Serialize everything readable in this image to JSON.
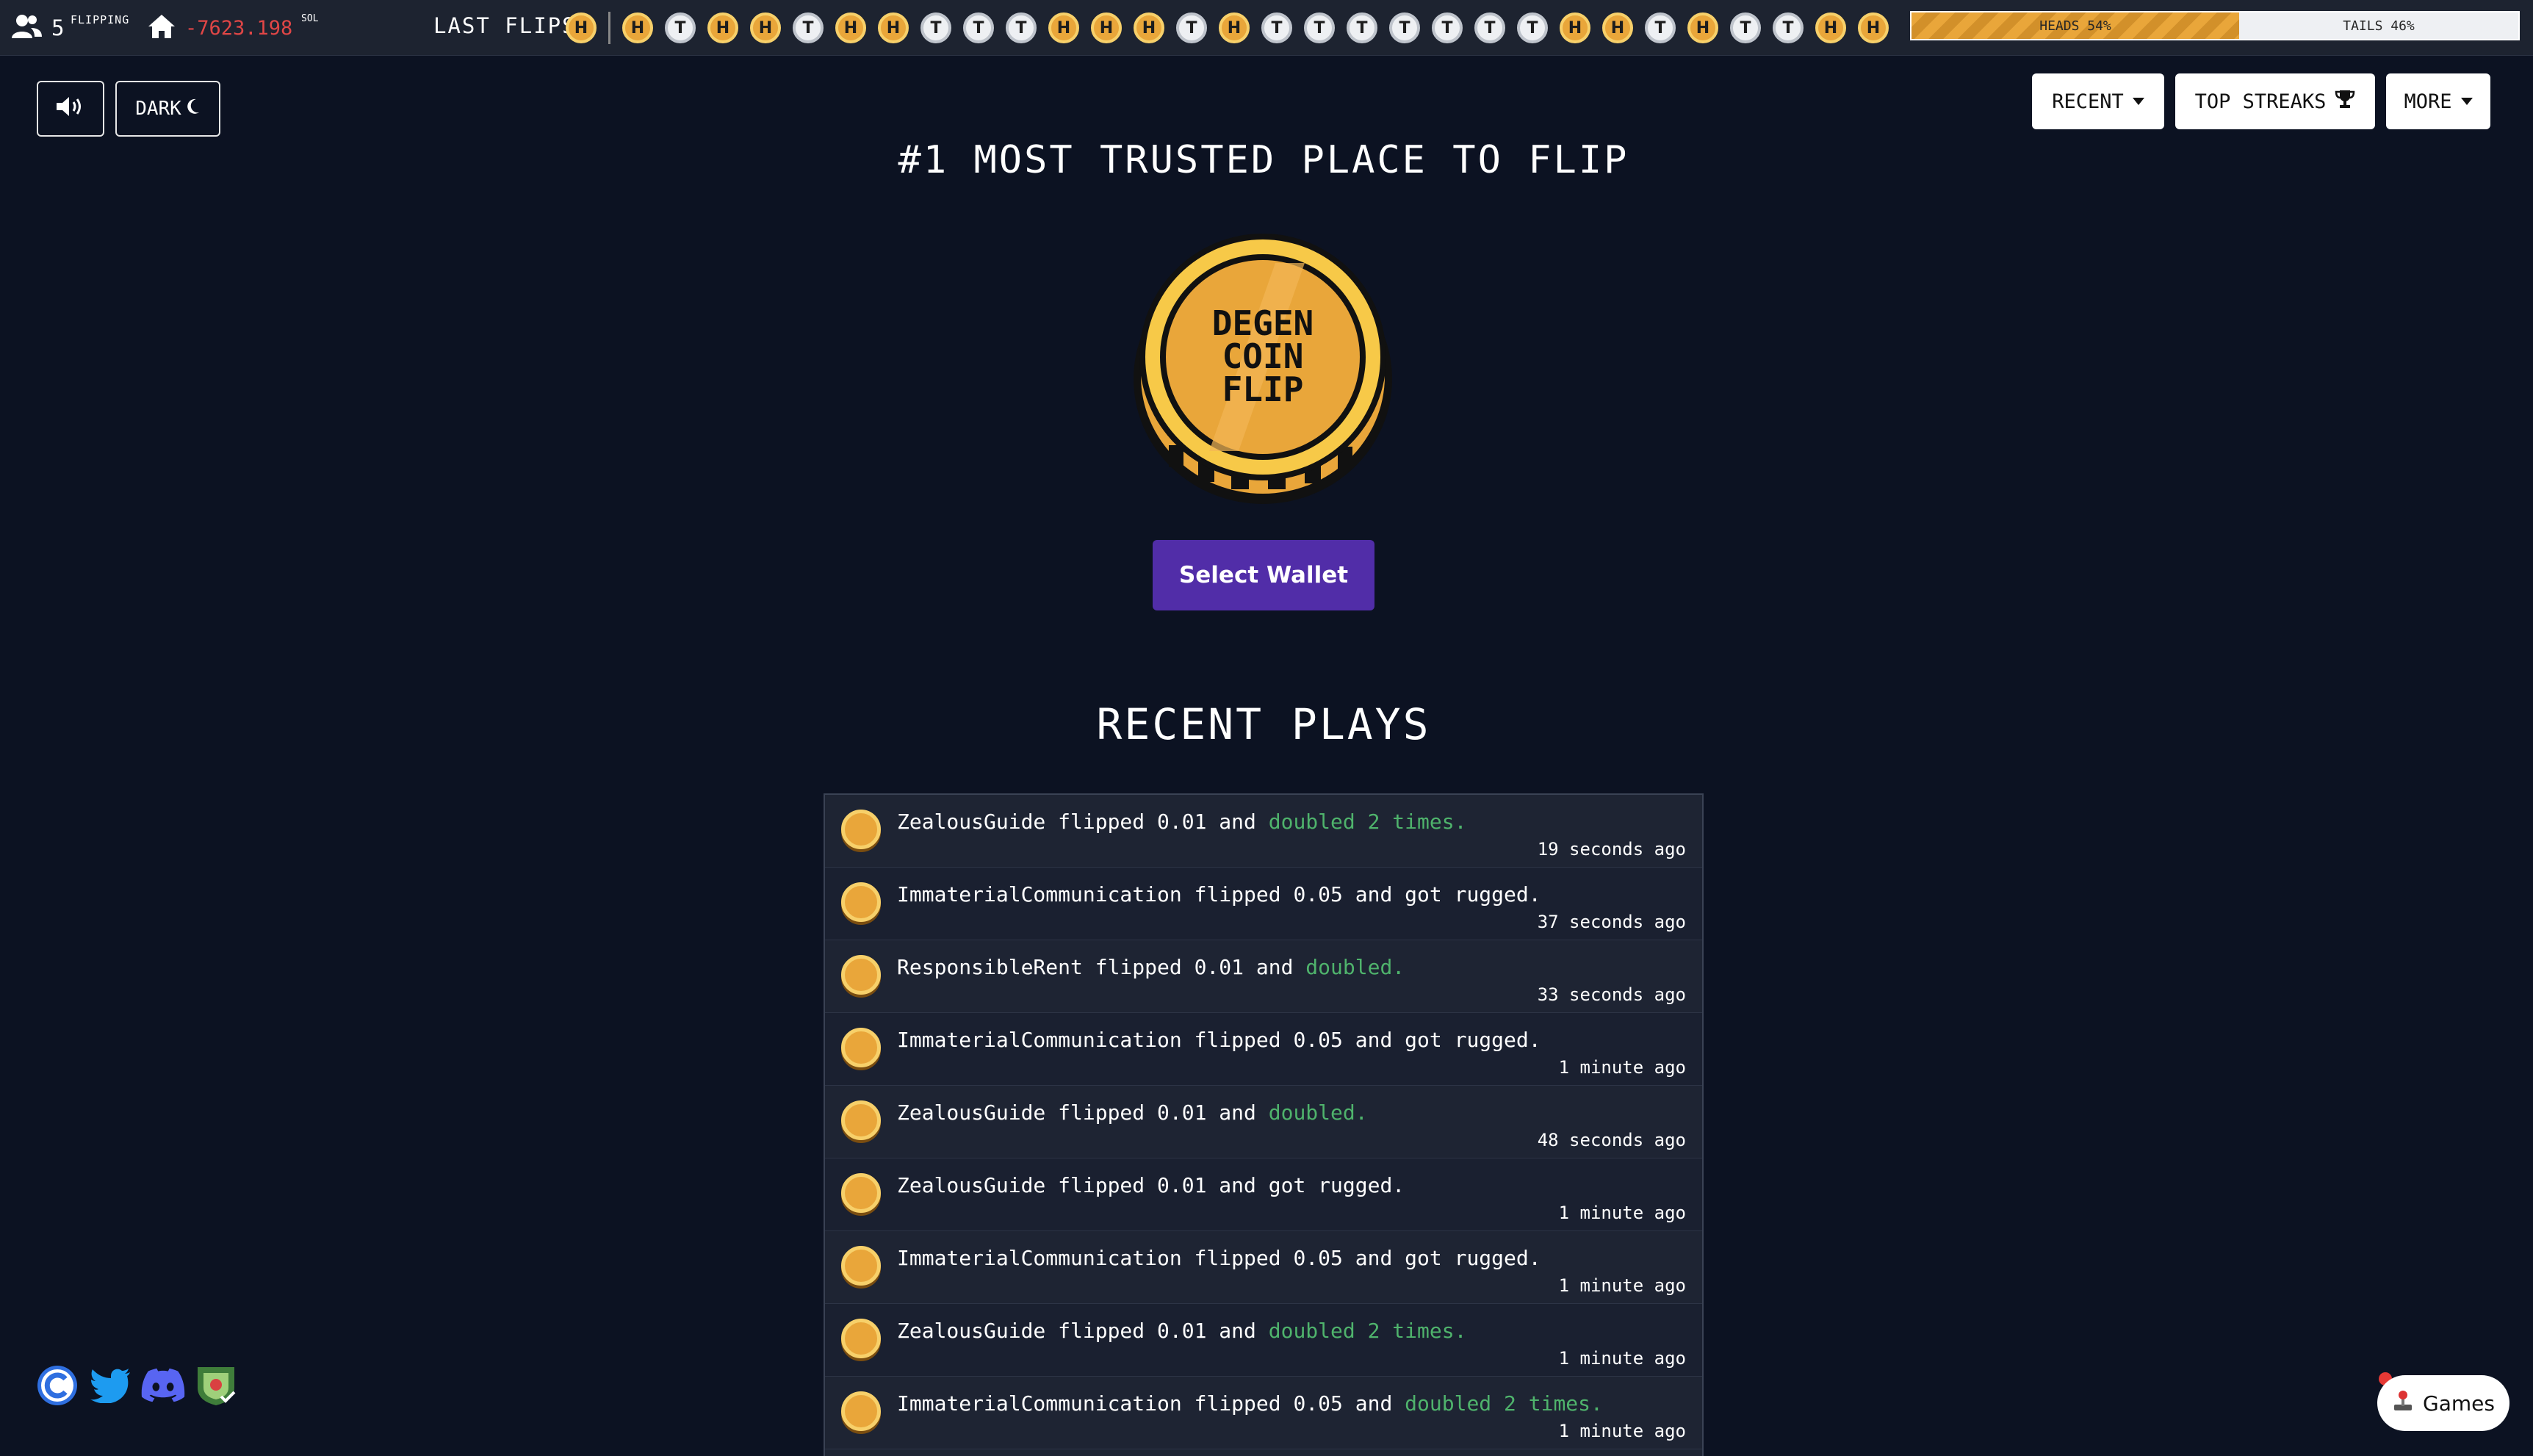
{
  "topbar": {
    "flipping_count": "5",
    "flipping_label": "FLIPPING",
    "balance": "-7623.198",
    "balance_unit": "SOL",
    "last_flips_label": "LAST FLIPS",
    "last_flips": [
      "H",
      "divider",
      "H",
      "T",
      "H",
      "H",
      "T",
      "H",
      "H",
      "T",
      "T",
      "T",
      "H",
      "H",
      "H",
      "T",
      "H",
      "T",
      "T",
      "T",
      "T",
      "T",
      "T",
      "T",
      "H",
      "H",
      "T",
      "H",
      "T",
      "T",
      "H",
      "H"
    ],
    "heads_label": "HEADS 54%",
    "tails_label": "TAILS 46%",
    "heads_percent": 54
  },
  "controls": {
    "dark_label": "DARK",
    "recent_label": "RECENT",
    "top_streaks_label": "TOP STREAKS",
    "more_label": "MORE"
  },
  "hero": {
    "headline": "#1 MOST TRUSTED PLACE TO FLIP",
    "coin_text": [
      "DEGEN",
      "COIN",
      "FLIP"
    ],
    "select_wallet_label": "Select Wallet"
  },
  "recent_plays": {
    "title": "RECENT PLAYS",
    "rows": [
      {
        "text": "ZealousGuide flipped 0.01 and ",
        "result": "doubled 2 times.",
        "win": true,
        "time": "19 seconds ago"
      },
      {
        "text": "ImmaterialCommunication flipped 0.05 and got rugged.",
        "result": "",
        "win": false,
        "time": "37 seconds ago"
      },
      {
        "text": "ResponsibleRent flipped 0.01 and ",
        "result": "doubled.",
        "win": true,
        "time": "33 seconds ago"
      },
      {
        "text": "ImmaterialCommunication flipped 0.05 and got rugged.",
        "result": "",
        "win": false,
        "time": "1 minute ago"
      },
      {
        "text": "ZealousGuide flipped 0.01 and ",
        "result": "doubled.",
        "win": true,
        "time": "48 seconds ago"
      },
      {
        "text": "ZealousGuide flipped 0.01 and got rugged.",
        "result": "",
        "win": false,
        "time": "1 minute ago"
      },
      {
        "text": "ImmaterialCommunication flipped 0.05 and got rugged.",
        "result": "",
        "win": false,
        "time": "1 minute ago"
      },
      {
        "text": "ZealousGuide flipped 0.01 and ",
        "result": "doubled 2 times.",
        "win": true,
        "time": "1 minute ago"
      },
      {
        "text": "ImmaterialCommunication flipped 0.05 and ",
        "result": "doubled 2 times.",
        "win": true,
        "time": "1 minute ago"
      }
    ]
  },
  "footer": {
    "socials": [
      "coinflip-logo-icon",
      "twitter-icon",
      "discord-icon",
      "shield-badge-icon"
    ],
    "games_label": "Games"
  },
  "colors": {
    "background": "#0c1222",
    "topbar": "#1d2330",
    "heads": "#e9a63a",
    "tails": "#eef0f3",
    "wallet_button": "#512da8",
    "win_text": "#4fb36c",
    "balance_negative": "#e04646"
  }
}
